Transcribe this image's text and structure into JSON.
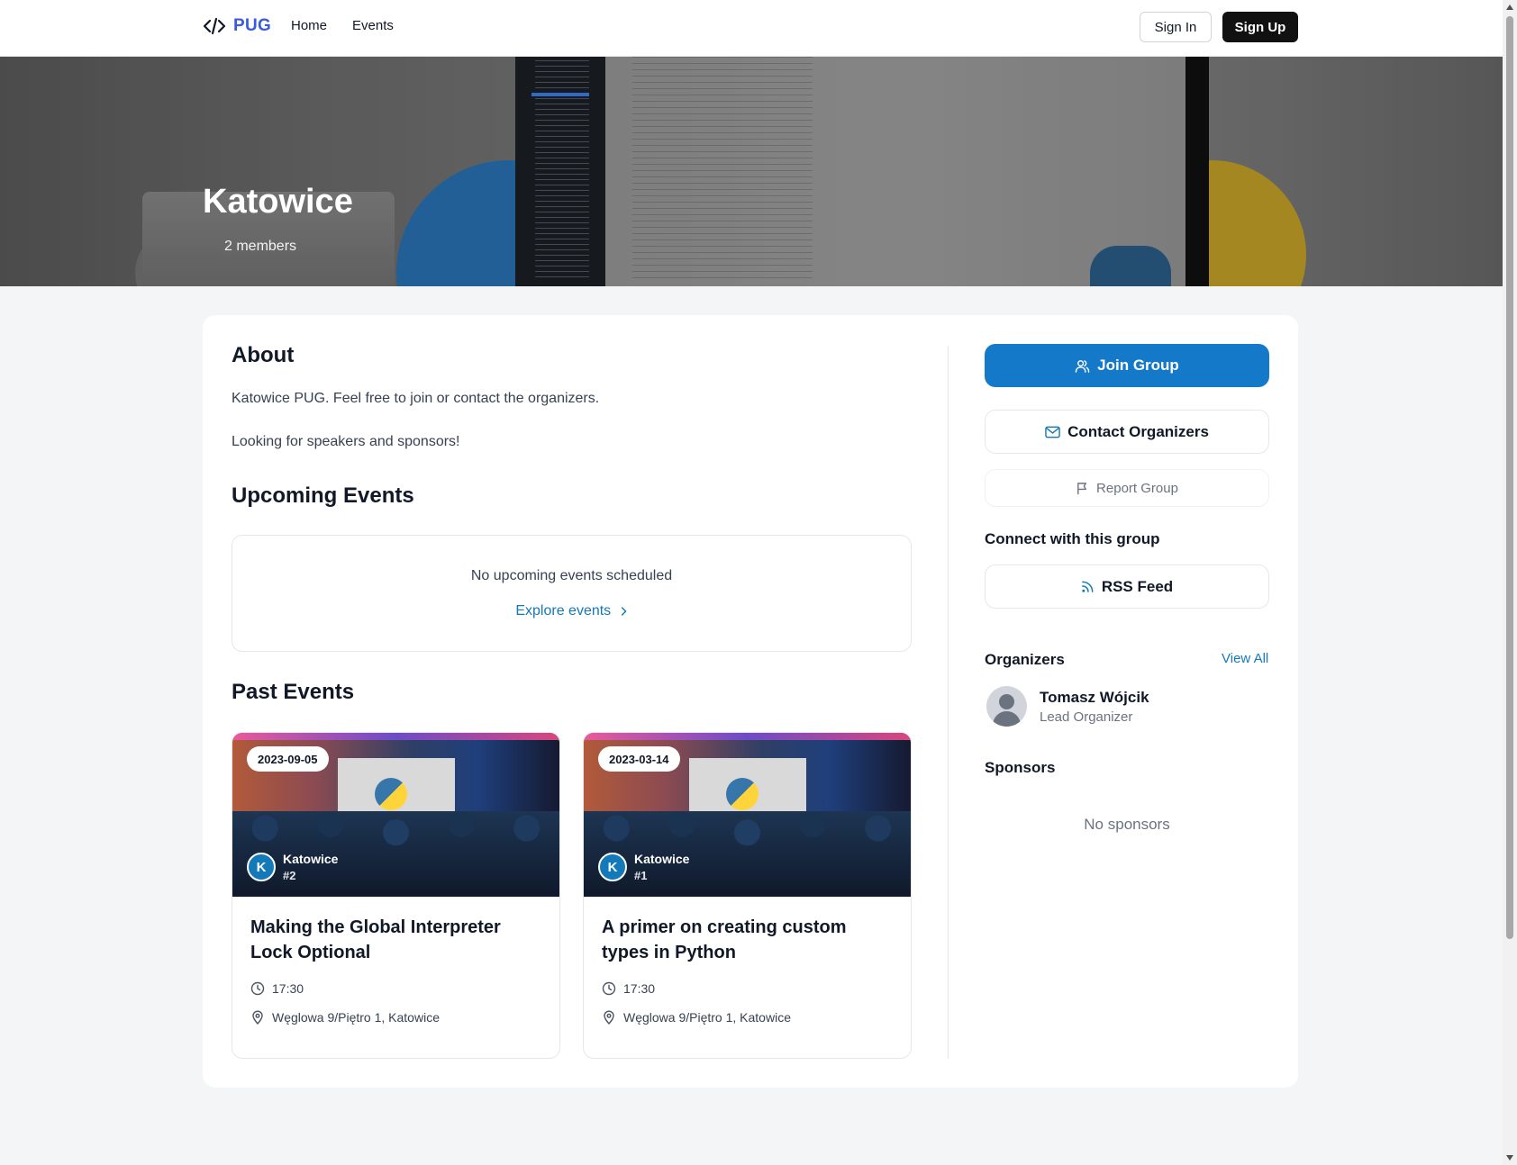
{
  "nav": {
    "brand": "PUG",
    "links": [
      "Home",
      "Events"
    ],
    "sign_in": "Sign In",
    "sign_up": "Sign Up"
  },
  "hero": {
    "title": "Katowice",
    "members": "2 members"
  },
  "about": {
    "heading": "About",
    "paragraphs": [
      "Katowice PUG. Feel free to join or contact the organizers.",
      "Looking for speakers and sponsors!"
    ]
  },
  "upcoming": {
    "heading": "Upcoming Events",
    "empty_message": "No upcoming events scheduled",
    "explore_label": "Explore events"
  },
  "past": {
    "heading": "Past Events",
    "events": [
      {
        "date": "2023-09-05",
        "group_initial": "K",
        "group_name": "Katowice",
        "event_number": "#2",
        "title": "Making the Global Interpreter Lock Optional",
        "time": "17:30",
        "location": "Węglowa 9/Piętro 1, Katowice"
      },
      {
        "date": "2023-03-14",
        "group_initial": "K",
        "group_name": "Katowice",
        "event_number": "#1",
        "title": "A primer on creating custom types in Python",
        "time": "17:30",
        "location": "Węglowa 9/Piętro 1, Katowice"
      }
    ]
  },
  "sidebar": {
    "join_label": "Join Group",
    "contact_label": "Contact Organizers",
    "report_label": "Report Group",
    "connect_heading": "Connect with this group",
    "rss_label": "RSS Feed",
    "organizers_heading": "Organizers",
    "view_all_label": "View All",
    "organizers": [
      {
        "name": "Tomasz Wójcik",
        "role": "Lead Organizer"
      }
    ],
    "sponsors_heading": "Sponsors",
    "no_sponsors": "No sponsors"
  },
  "colors": {
    "accent": "#1479c9",
    "brand": "#3b5bdb",
    "link": "#1479b8"
  },
  "icons": {
    "brand": "code-icon",
    "join": "users-icon",
    "contact": "mail-icon",
    "report": "flag-icon",
    "rss": "rss-icon",
    "time": "clock-icon",
    "location": "map-pin-icon",
    "explore": "chevron-right-icon"
  }
}
